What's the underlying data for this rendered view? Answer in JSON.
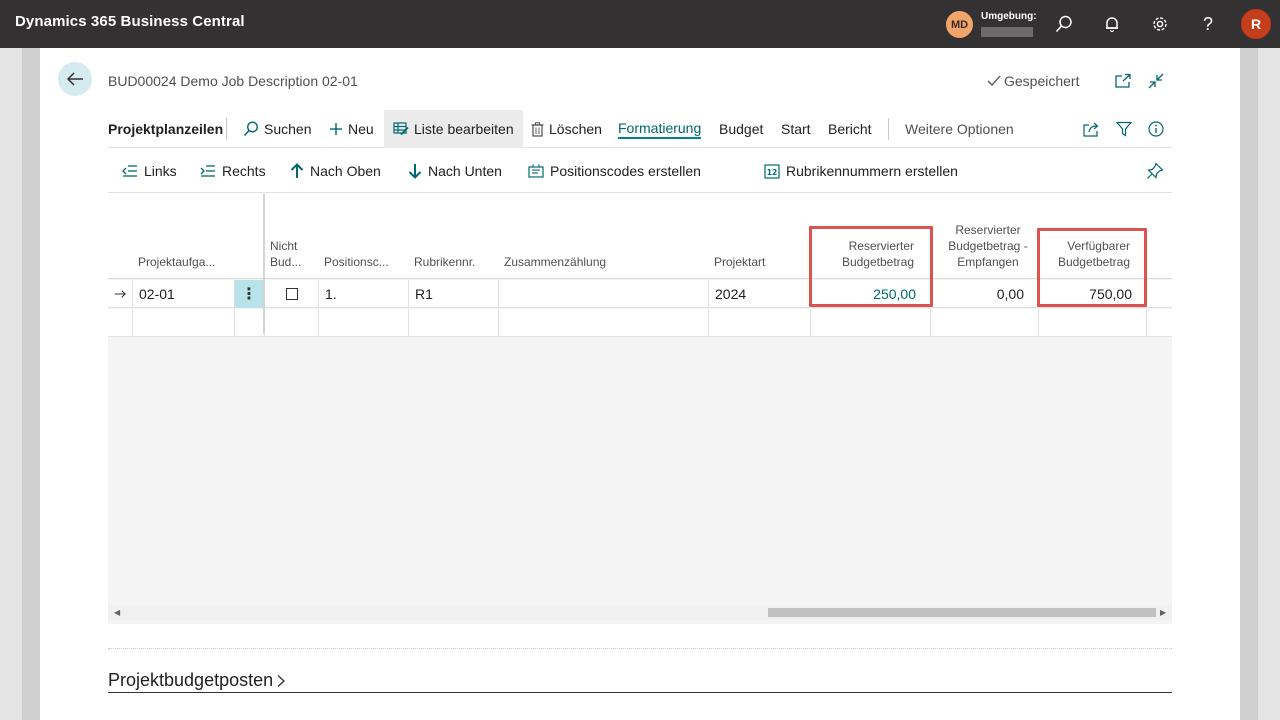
{
  "topbar": {
    "app_title": "Dynamics 365 Business Central",
    "company_initials": "MD",
    "env_label": "Umgebung:",
    "user_initial": "R",
    "icons": [
      "search-icon",
      "bell-icon",
      "gear-icon",
      "help-icon"
    ]
  },
  "page": {
    "title": "BUD00024 Demo Job Description 02-01",
    "saved_label": "Gespeichert"
  },
  "actionbar": {
    "section": "Projektplanzeilen",
    "search": "Suchen",
    "new": "Neu",
    "edit_list": "Liste bearbeiten",
    "delete": "Löschen",
    "formatting": "Formatierung",
    "budget": "Budget",
    "start": "Start",
    "report": "Bericht",
    "more": "Weitere Optionen"
  },
  "subbar": {
    "left": "Links",
    "right": "Rechts",
    "up": "Nach Oben",
    "down": "Nach Unten",
    "create_position_codes": "Positionscodes erstellen",
    "create_heading_numbers": "Rubrikennummern erstellen"
  },
  "grid": {
    "headers": {
      "task": "Projektaufga...",
      "not_budget_1": "Nicht",
      "not_budget_2": "Bud...",
      "position": "Positionsc...",
      "heading": "Rubrikennr.",
      "totaling": "Zusammenzählung",
      "job_type": "Projektart",
      "reserved_1": "Reservierter",
      "reserved_2": "Budgetbetrag",
      "received_1": "Reservierter",
      "received_2": "Budgetbetrag -",
      "received_3": "Empfangen",
      "available_1": "Verfügbarer",
      "available_2": "Budgetbetrag"
    },
    "rows": [
      {
        "task": "02-01",
        "not_budget": false,
        "position": "1.",
        "heading": "R1",
        "totaling": "",
        "job_type": "2024",
        "reserved": "250,00",
        "received": "0,00",
        "available": "750,00"
      }
    ]
  },
  "footer": {
    "section_title": "Projektbudgetposten"
  }
}
